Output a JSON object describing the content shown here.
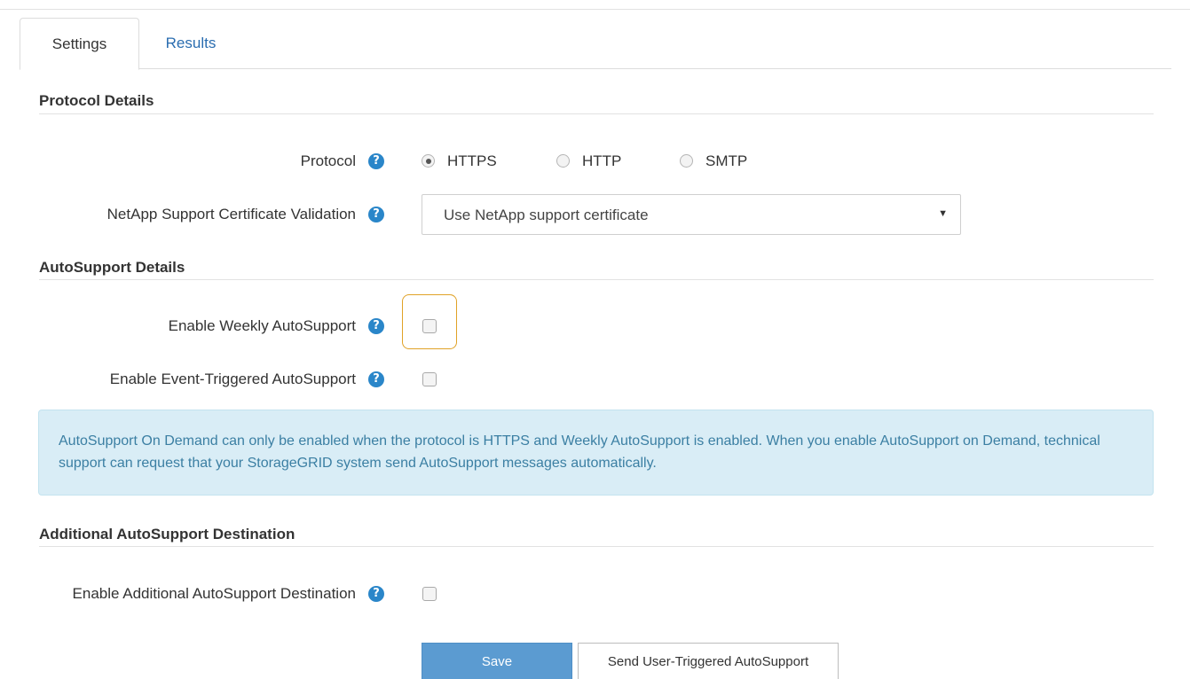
{
  "tabs": {
    "settings": "Settings",
    "results": "Results"
  },
  "protocol_section": {
    "title": "Protocol Details",
    "protocol_label": "Protocol",
    "options": [
      "HTTPS",
      "HTTP",
      "SMTP"
    ],
    "selected": "HTTPS",
    "cert_label": "NetApp Support Certificate Validation",
    "cert_value": "Use NetApp support certificate"
  },
  "autosupport_section": {
    "title": "AutoSupport Details",
    "weekly_label": "Enable Weekly AutoSupport",
    "weekly_checked": false,
    "event_label": "Enable Event-Triggered AutoSupport",
    "event_checked": false,
    "info_text": "AutoSupport On Demand can only be enabled when the protocol is HTTPS and Weekly AutoSupport is enabled. When you enable AutoSupport on Demand, technical support can request that your StorageGRID system send AutoSupport messages automatically."
  },
  "destination_section": {
    "title": "Additional AutoSupport Destination",
    "enable_label": "Enable Additional AutoSupport Destination",
    "enable_checked": false
  },
  "buttons": {
    "save": "Save",
    "send": "Send User-Triggered AutoSupport"
  },
  "icons": {
    "help": "question-circle-icon",
    "dropdown": "caret-down-icon"
  },
  "colors": {
    "accent": "#2a86c9",
    "link": "#2a6db0",
    "save_button": "#5b9bd1",
    "info_bg": "#d9edf6",
    "info_text": "#3b7fa3",
    "focus": "#e0a227"
  }
}
